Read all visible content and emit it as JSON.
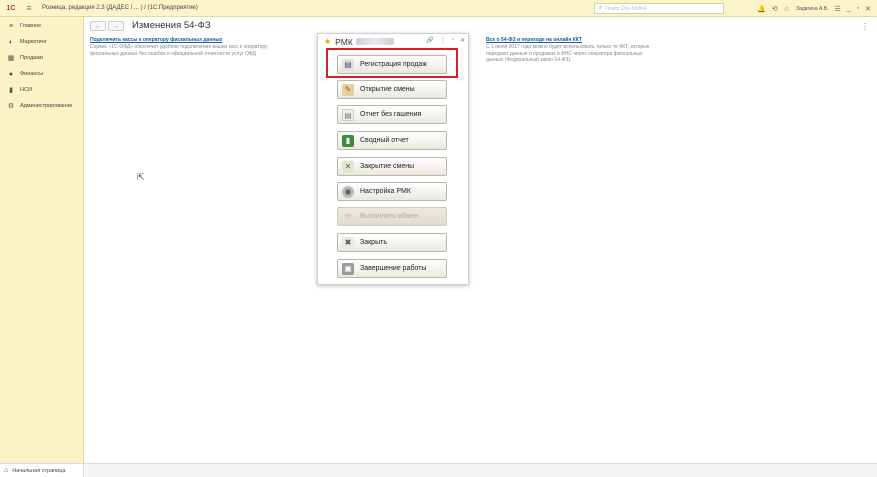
{
  "topbar": {
    "logo": "1С",
    "title": "Розница, редакция 2.3 (ДАДЕС / ... ) / (1С:Предприятие)",
    "search_placeholder": "Поиск Ctrl+Shift+F",
    "user": "Задвгина А.В."
  },
  "sidebar": {
    "items": [
      {
        "icon": "menu-icon",
        "glyph": "≡",
        "label": "Главное"
      },
      {
        "icon": "marketing-icon",
        "glyph": "◐",
        "label": "Маркетинг"
      },
      {
        "icon": "sales-icon",
        "glyph": "▦",
        "label": "Продажи"
      },
      {
        "icon": "finance-icon",
        "glyph": "●",
        "label": "Финансы"
      },
      {
        "icon": "nsi-icon",
        "glyph": "▮",
        "label": "НСИ"
      },
      {
        "icon": "gear-icon",
        "glyph": "⚙",
        "label": "Администрирование"
      }
    ]
  },
  "main": {
    "title": "Изменения 54-ФЗ",
    "left_info": {
      "link": "Подключить кассы к оператору фискальных данных",
      "text": "Сервис «1С-ОФД» обеспечит удобное подключение ваших касс к оператору фискальных данных без ошибок и официальной отчетности услуг ОФД"
    },
    "right_info": {
      "link": "Все о 54-ФЗ и переходе на онлайн ККТ",
      "text": "С 1 июля 2017 года можно будет использовать только те ККТ, которые передают данные о продажах в ФНС через оператора фискальных данных (Федеральный закон 54-ФЗ)."
    }
  },
  "dialog": {
    "title": "РМК",
    "buttons": [
      {
        "label": "Регистрация продаж",
        "icon": "receipt-icon",
        "glyph": "🖹",
        "enabled": true
      },
      {
        "label": "Открытие смены",
        "icon": "open-shift-icon",
        "glyph": "✎",
        "enabled": true
      },
      {
        "label": "Отчет без гашения",
        "icon": "report-icon",
        "glyph": "▤",
        "enabled": true
      },
      {
        "label": "Сводный отчет",
        "icon": "summary-report-icon",
        "glyph": "▮",
        "enabled": true
      },
      {
        "label": "Закрытие смены",
        "icon": "close-shift-icon",
        "glyph": "✕",
        "enabled": true
      },
      {
        "label": "Настройка РМК",
        "icon": "settings-icon",
        "glyph": "◉",
        "enabled": true
      },
      {
        "label": "Выполнить обмен",
        "icon": "exchange-icon",
        "glyph": "⟳",
        "enabled": false
      },
      {
        "label": "Закрыть",
        "icon": "close-doc-icon",
        "glyph": "✖",
        "enabled": true
      },
      {
        "label": "Завершение работы",
        "icon": "lock-icon",
        "glyph": "🔒",
        "enabled": true
      }
    ]
  },
  "bottombar": {
    "home_tab": "Начальная страница"
  },
  "colors": {
    "highlight": "#d62020",
    "sidebar_bg": "#fbf3c5",
    "link": "#1a5aa8"
  }
}
